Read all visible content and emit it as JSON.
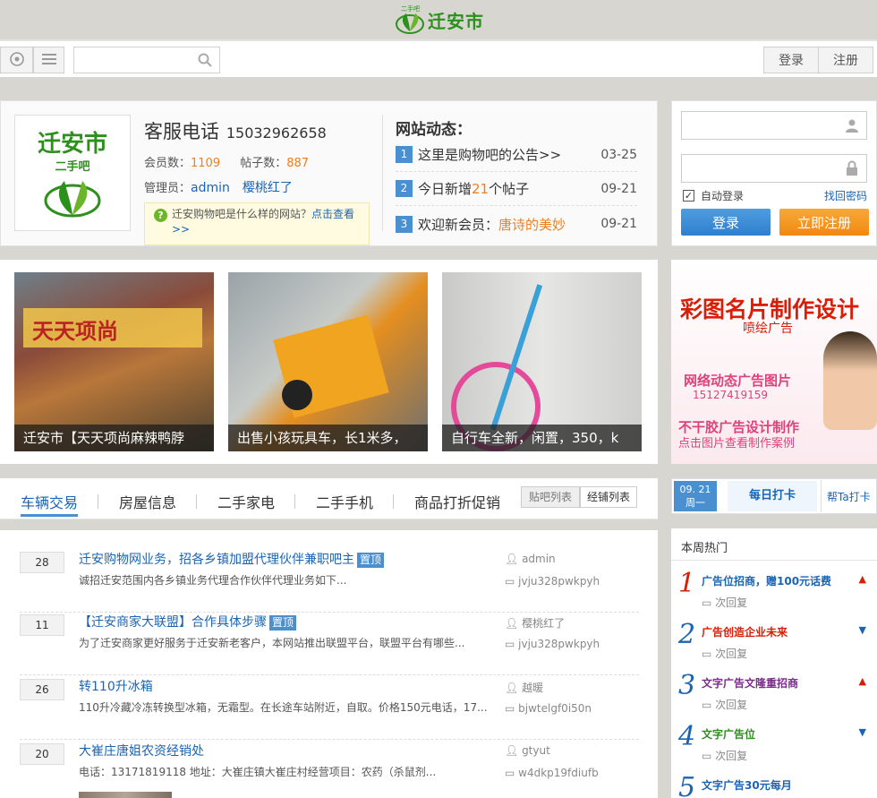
{
  "logo": {
    "brand": "迁安市",
    "tiny": "二手吧"
  },
  "nav": {
    "login": "登录",
    "register": "注册",
    "search_placeholder": ""
  },
  "info": {
    "phone_label": "客服电话",
    "phone": "15032962658",
    "members_label": "会员数：",
    "members": "1109",
    "posts_label": "帖子数：",
    "posts": "887",
    "admin_label": "管理员：",
    "admins": [
      "admin",
      "樱桃红了"
    ],
    "tip_text": "迁安购物吧是什么样的网站？",
    "tip_link": "点击查看>>",
    "logo_title": "迁安市",
    "logo_sub": "二手吧"
  },
  "news": {
    "title": "网站动态：",
    "items": [
      {
        "num": "1",
        "text": "这里是购物吧的公告>>",
        "date": "03-25"
      },
      {
        "num": "2",
        "pre": "今日新增",
        "count": "21",
        "post": "个帖子",
        "date": "09-21"
      },
      {
        "num": "3",
        "pre": "欢迎新会员：",
        "name": "唐诗的美妙",
        "date": "09-21"
      }
    ]
  },
  "login": {
    "auto_login": "自动登录",
    "find_password": "找回密码",
    "login_btn": "登录",
    "register_btn": "立即注册"
  },
  "photos": [
    {
      "caption": "迁安市【天天项尚麻辣鸭脖"
    },
    {
      "caption": "出售小孩玩具车，长1米多，"
    },
    {
      "caption": "自行车全新，闲置，350，k"
    }
  ],
  "ad": {
    "title": "彩图名片制作设计",
    "sub": "喷绘广告",
    "line1": "网络动态广告图片",
    "phone": "15127419159",
    "line2": "不干胶广告设计制作",
    "line3": "点击图片查看制作案例"
  },
  "tabs": {
    "items": [
      "车辆交易",
      "房屋信息",
      "二手家电",
      "二手手机",
      "商品打折促销"
    ],
    "active": "车辆交易",
    "view_post": "贴吧列表",
    "view_shop": "经铺列表"
  },
  "calendar": {
    "date": "09. 21",
    "weekday": "周一",
    "checkin": "每日打卡",
    "help": "帮Ta打卡"
  },
  "threads": [
    {
      "count": "28",
      "title": "迁安购物网业务，招各乡镇加盟代理伙伴兼职吧主",
      "top": "置顶",
      "summary": "诚招迁安范围内各乡镇业务代理合作伙伴代理业务如下...",
      "author": "admin",
      "last": "jvju328pwkpyh"
    },
    {
      "count": "11",
      "title": "【迁安商家大联盟】合作具体步骤",
      "top": "置顶",
      "summary": "为了迁安商家更好服务于迁安新老客户，本网站推出联盟平台，联盟平台有哪些...",
      "author": "樱桃红了",
      "last": "jvju328pwkpyh"
    },
    {
      "count": "26",
      "title": "转110升冰箱",
      "top": "",
      "summary": "110升冷藏冷冻转换型冰箱，无霜型。在长途车站附近，自取。价格150元电话，17...",
      "author": "越暖",
      "last": "bjwtelgf0i50n"
    },
    {
      "count": "20",
      "title": "大崔庄唐姐农资经销处",
      "top": "",
      "summary": "电话：13171819118 地址：大崔庄镇大崔庄村经营项目：农药（杀鼠剂...",
      "author": "gtyut",
      "last": "w4dkp19fdiufb"
    }
  ],
  "hot": {
    "title": "本周热门",
    "items": [
      {
        "n": "1",
        "title": "广告位招商，赠100元话费",
        "color": "#1b64b4",
        "reply": "次回复",
        "dir": "up"
      },
      {
        "n": "2",
        "title": "广告创造企业未来",
        "color": "#d81e06",
        "reply": "次回复",
        "dir": "down"
      },
      {
        "n": "3",
        "title": "文字广告文隆重招商",
        "color": "#7a2b8c",
        "reply": "次回复",
        "dir": "up"
      },
      {
        "n": "4",
        "title": "文字广告位",
        "color": "#2d8f1c",
        "reply": "次回复",
        "dir": "down"
      },
      {
        "n": "5",
        "title": "文字广告30元每月",
        "color": "#1b64b4",
        "reply": "",
        "dir": ""
      }
    ]
  },
  "colors": {
    "accent": "#4a8fcf",
    "orange": "#f07d1e",
    "green": "#2d8f1c"
  }
}
